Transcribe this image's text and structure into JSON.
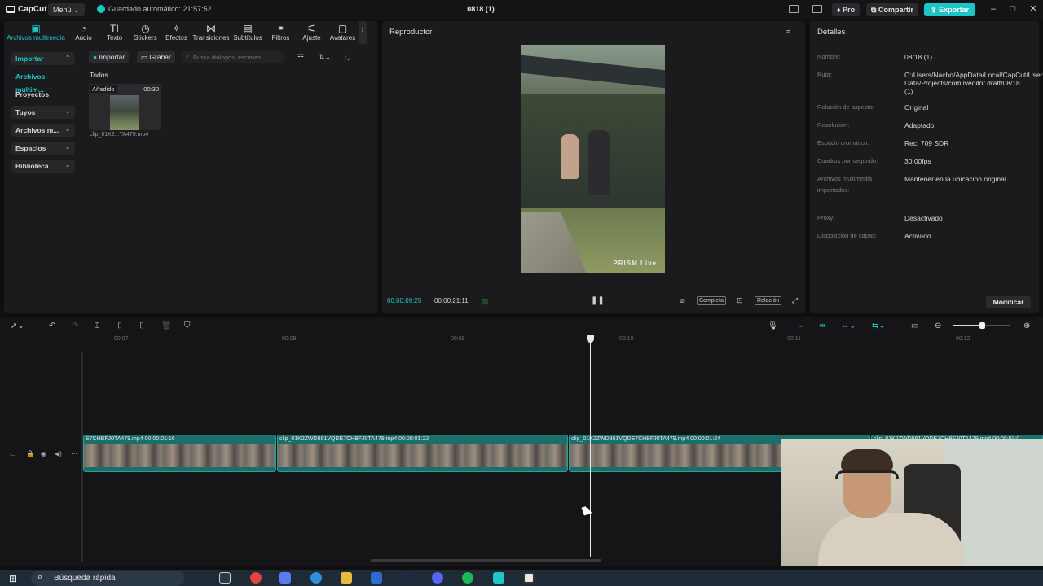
{
  "app": {
    "logo": "CapCut",
    "menu_label": "Menú",
    "autosave": "Guardado automático: 21:57:52",
    "project_title": "0818 (1)",
    "pro_label": "Pro",
    "share_label": "Compartir",
    "export_label": "Exportar",
    "accent_color": "#1ec6c6"
  },
  "tabs": [
    {
      "label": "Archivos multimedia",
      "icon": "media-icon"
    },
    {
      "label": "Audio",
      "icon": "audio-icon"
    },
    {
      "label": "Texto",
      "icon": "text-icon"
    },
    {
      "label": "Stickers",
      "icon": "sticker-icon"
    },
    {
      "label": "Efectos",
      "icon": "effects-icon"
    },
    {
      "label": "Transiciones",
      "icon": "transition-icon"
    },
    {
      "label": "Subtítulos",
      "icon": "subtitle-icon"
    },
    {
      "label": "Filtros",
      "icon": "filter-icon"
    },
    {
      "label": "Ajuste",
      "icon": "adjust-icon"
    },
    {
      "label": "Avatares",
      "icon": "avatar-icon"
    }
  ],
  "sidebar": {
    "items": [
      {
        "label": "Importar"
      },
      {
        "label": "Archivos multim..."
      },
      {
        "label": "Proyectos secun..."
      },
      {
        "label": "Tuyos"
      },
      {
        "label": "Archivos m..."
      },
      {
        "label": "Espacios"
      },
      {
        "label": "Biblioteca"
      }
    ]
  },
  "media": {
    "import_label": "Importar",
    "record_label": "Grabar",
    "search_placeholder": "Busca diálogos, escenas ...",
    "filter_all": "Todos",
    "item": {
      "badge": "Añadido",
      "duration": "00:30",
      "name": "clip_01K2...TA479.mp4"
    }
  },
  "player": {
    "title": "Reproductor",
    "watermark": "PRISM Live",
    "current_time": "00:00:09:25",
    "total_time": "00:00:21:11",
    "full_label": "Completa",
    "ratio_label": "Relación"
  },
  "details": {
    "title": "Detalles",
    "rows": [
      {
        "key": "Nombre:",
        "value": "08/18 (1)"
      },
      {
        "key": "Ruta:",
        "value": "C:/Users/Nacho/AppData/Local/CapCut/User Data/Projects/com.lveditor.draft/08/18 (1)"
      },
      {
        "key": "Relación de aspecto:",
        "value": "Original"
      },
      {
        "key": "Resolución:",
        "value": "Adaptado"
      },
      {
        "key": "Espacio cromático:",
        "value": "Rec. 709 SDR"
      },
      {
        "key": "Cuadros por segundo:",
        "value": "30.00fps"
      },
      {
        "key": "Archivos multimedia importados:",
        "value": "Mantener en la ubicación original"
      },
      {
        "key": "Proxy:",
        "value": "Desactivado"
      },
      {
        "key": "Disposición de capas:",
        "value": "Activado"
      }
    ],
    "modify_label": "Modificar"
  },
  "timeline": {
    "ruler": [
      "00:07",
      "00:08",
      "00:09",
      "00:10",
      "00:11",
      "00:12"
    ],
    "clips": [
      {
        "label": "E7CHBFJ0TA479.mp4   00:00:01:16"
      },
      {
        "label": "clip_01K2ZWD861VQDE7CHBFJ0TA479.mp4   00:00:01:22"
      },
      {
        "label": "clip_01K2ZWD861VQDE7CHBFJ0TA479.mp4   00:00:01:24"
      },
      {
        "label": "clip_01K2ZWD861VQDE7CHBFJ0TA479.mp4   00:00:03:0"
      }
    ]
  },
  "taskbar": {
    "search_placeholder": "Búsqueda rápida"
  }
}
